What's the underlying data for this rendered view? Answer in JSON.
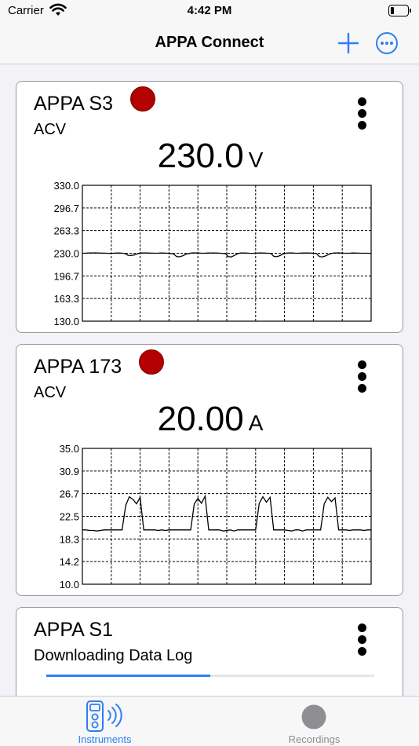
{
  "status_bar": {
    "carrier": "Carrier",
    "time": "4:42 PM"
  },
  "nav": {
    "title": "APPA Connect",
    "add_icon": "plus-icon",
    "more_icon": "ellipsis-circle-icon"
  },
  "colors": {
    "accent": "#2f7ef5",
    "record": "#b30000",
    "tab_inactive": "#8e8e93"
  },
  "instruments": [
    {
      "name": "APPA S3",
      "mode": "ACV",
      "reading": "230.0",
      "unit": "V",
      "recording": true,
      "chart_data": {
        "type": "line",
        "y_ticks": [
          "330.0",
          "296.7",
          "263.3",
          "230.0",
          "196.7",
          "163.3",
          "130.0"
        ],
        "ylim": [
          130.0,
          330.0
        ],
        "grid": true,
        "series": [
          {
            "values": [
              230.0,
              230.1,
              230.3,
              230.5,
              230.6,
              230.4,
              230.2,
              230.1,
              230.0,
              229.9,
              230.0,
              230.2,
              230.3,
              230.1,
              229.5,
              227.0,
              226.6,
              227.4,
              229.0,
              230.3,
              230.5,
              230.4,
              230.2,
              230.1,
              230.0,
              230.1,
              230.3,
              230.2,
              230.0,
              229.6,
              229.0,
              225.2,
              224.8,
              226.2,
              228.4,
              229.7,
              230.4,
              230.6,
              230.3,
              230.1,
              230.0,
              230.2,
              230.4,
              230.5,
              230.3,
              230.1,
              229.8,
              229.6,
              225.0,
              224.6,
              226.8,
              229.2,
              230.3,
              230.5,
              230.2,
              230.0,
              229.9,
              230.1,
              230.3,
              230.4,
              230.2,
              230.0,
              229.8,
              225.4,
              224.9,
              226.5,
              228.9,
              230.1,
              230.5,
              230.3,
              230.1,
              230.0,
              230.2,
              230.3,
              230.4,
              230.2,
              230.0,
              229.5,
              225.0,
              224.7,
              226.1,
              228.3,
              229.9,
              230.5,
              230.6,
              230.3,
              230.1,
              230.0,
              230.1,
              230.3,
              230.2,
              230.1,
              230.0,
              230.0,
              230.0,
              229.9
            ]
          }
        ]
      }
    },
    {
      "name": "APPA 173",
      "mode": "ACV",
      "reading": "20.00",
      "unit": "A",
      "recording": true,
      "chart_data": {
        "type": "line",
        "y_ticks": [
          "35.0",
          "30.9",
          "26.7",
          "22.5",
          "18.3",
          "14.2",
          "10.0"
        ],
        "ylim": [
          10.0,
          35.0
        ],
        "grid": true,
        "series": [
          {
            "values": [
              20.0,
              20.0,
              19.9,
              19.9,
              19.8,
              19.9,
              20.0,
              20.0,
              20.0,
              20.0,
              20.0,
              20.0,
              24.5,
              26.1,
              25.6,
              24.8,
              26.0,
              20.0,
              20.0,
              20.0,
              20.0,
              19.9,
              20.0,
              19.9,
              20.0,
              20.0,
              20.0,
              20.0,
              20.0,
              20.0,
              20.0,
              24.8,
              25.8,
              24.9,
              26.2,
              20.0,
              20.0,
              20.0,
              20.0,
              19.8,
              19.9,
              20.0,
              19.8,
              20.0,
              20.0,
              20.0,
              20.0,
              20.0,
              20.0,
              24.9,
              26.1,
              25.1,
              26.0,
              20.0,
              20.0,
              20.0,
              20.0,
              19.9,
              19.8,
              20.0,
              20.0,
              19.8,
              20.0,
              20.0,
              20.0,
              20.0,
              20.0,
              24.8,
              26.0,
              25.2,
              25.9,
              20.0,
              20.0,
              20.0,
              19.9,
              20.0,
              20.0,
              20.0,
              19.9,
              20.0,
              20.0
            ]
          }
        ]
      }
    },
    {
      "name": "APPA S1",
      "mode": "Downloading Data Log",
      "recording": false,
      "progress": 0.5
    }
  ],
  "tabs": [
    {
      "label": "Instruments",
      "icon": "instrument-wireless-icon",
      "active": true
    },
    {
      "label": "Recordings",
      "icon": "record-circle-icon",
      "active": false
    }
  ]
}
